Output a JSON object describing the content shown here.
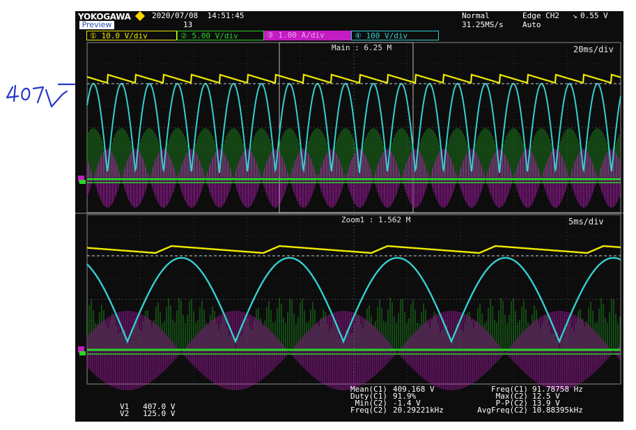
{
  "header": {
    "brand": "YOKOGAWA",
    "mode_label": "Preview",
    "datetime": "2020/07/08  14:51:45",
    "acq_count": "13",
    "trigger_mode": "Normal",
    "sample_rate": "31.25MS/s",
    "trigger_type": "Edge CH2",
    "trigger_level": "0.55 V",
    "trigger_auto": "Auto"
  },
  "channels": [
    {
      "label": "① 10.0 V/div",
      "color": "#f2ea00"
    },
    {
      "label": "② 5.00 V/div",
      "color": "#27d627"
    },
    {
      "label": "③ 1.00 A/div",
      "color": "#c21cc2"
    },
    {
      "label": "④ 100 V/div",
      "color": "#35d0d0"
    }
  ],
  "main_window": {
    "label": "Main : 6.25 M",
    "timebase": "20ms/div"
  },
  "zoom_window": {
    "label": "Zoom1 : 1.562 M",
    "timebase": "5ms/div"
  },
  "cursors": {
    "v1": "V1   407.0 V",
    "v2": "V2   125.0 V"
  },
  "measurements": {
    "left": [
      {
        "label": "Mean(C1)",
        "value": "409.168 V"
      },
      {
        "label": "Duty(C1)",
        "value": "91.9%"
      },
      {
        "label": "Min(C2)",
        "value": "-1.4 V"
      },
      {
        "label": "Freq(C2)",
        "value": "20.29221kHz"
      }
    ],
    "right": [
      {
        "label": "Freq(C1)",
        "value": "91.78758 Hz"
      },
      {
        "label": "Max(C2)",
        "value": "12.5 V"
      },
      {
        "label": "P-P(C2)",
        "value": "13.9 V"
      },
      {
        "label": "AvgFreq(C2)",
        "value": "10.88395kHz"
      }
    ]
  },
  "annotation": {
    "handwritten_text": "407V"
  }
}
